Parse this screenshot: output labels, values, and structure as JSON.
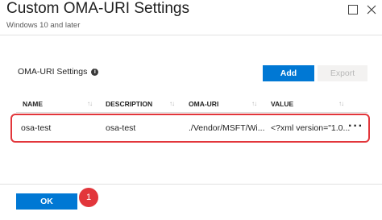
{
  "header": {
    "title": "Custom OMA-URI Settings",
    "subtitle": "Windows 10 and later"
  },
  "section": {
    "label": "OMA-URI Settings",
    "add_label": "Add",
    "export_label": "Export"
  },
  "table": {
    "columns": [
      "NAME",
      "DESCRIPTION",
      "OMA-URI",
      "VALUE"
    ],
    "rows": [
      {
        "name": "osa-test",
        "description": "osa-test",
        "oma_uri": "./Vendor/MSFT/Wi...",
        "value": "<?xml version=\"1.0..."
      }
    ]
  },
  "footer": {
    "ok_label": "OK",
    "step_number": "1"
  },
  "colors": {
    "accent": "#0078d4",
    "highlight": "#e2363b"
  }
}
